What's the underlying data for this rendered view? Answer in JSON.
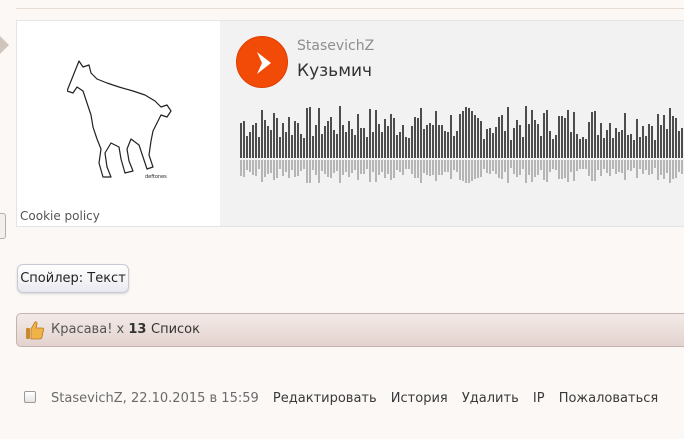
{
  "embed": {
    "cookie_label": "Cookie policy",
    "artist": "StasevichZ",
    "track": "Кузьмич",
    "accent_color": "#f24b07",
    "artwork_caption": "deftones"
  },
  "spoiler": {
    "label": "Спойлер: Текст"
  },
  "likes": {
    "label": "Красава!",
    "times": "x",
    "count": "13",
    "list_label": "Список"
  },
  "footer": {
    "author_date": "StasevichZ, 22.10.2015 в 15:59",
    "links": [
      "Редактировать",
      "История",
      "Удалить",
      "IP",
      "Пожаловаться"
    ]
  }
}
